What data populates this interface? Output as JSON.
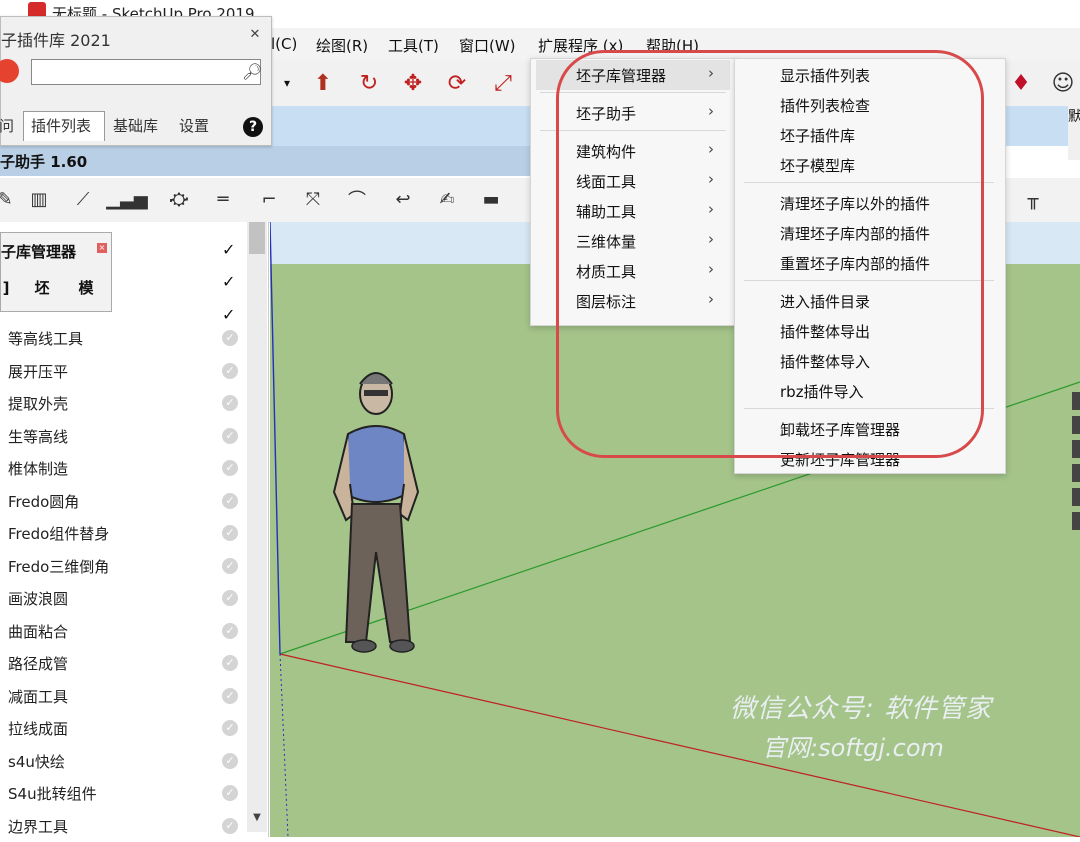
{
  "window": {
    "title": "无标题 - SketchUp Pro 2019"
  },
  "menubar": {
    "items": [
      "l(C)",
      "绘图(R)",
      "工具(T)",
      "窗口(W)",
      "扩展程序 (x)",
      "帮助(H)"
    ]
  },
  "plugin_panel": {
    "title": "子插件库 2021",
    "search_placeholder": "",
    "tabs": [
      "问",
      "插件列表",
      "基础库",
      "设置"
    ],
    "active_tab": "插件列表",
    "help_label": "?"
  },
  "assistant_bar": {
    "title": "子助手 1.60"
  },
  "manager_panel": {
    "title": "子库管理器",
    "buttons": [
      "]",
      "坯",
      "模"
    ]
  },
  "plugin_list": {
    "items": [
      "等高线工具",
      "展开压平",
      "提取外壳",
      "生等高线",
      "椎体制造",
      "Fredo圆角",
      "Fredo组件替身",
      "Fredo三维倒角",
      "画波浪圆",
      "曲面粘合",
      "路径成管",
      "减面工具",
      "拉线成面",
      "s4u快绘",
      "S4u批转组件",
      "边界工具"
    ]
  },
  "menu_level1": {
    "items": [
      {
        "label": "坯子库管理器",
        "submenu": true
      },
      {
        "label": "坯子助手",
        "submenu": true
      },
      {
        "label": "建筑构件",
        "submenu": true
      },
      {
        "label": "线面工具",
        "submenu": true
      },
      {
        "label": "辅助工具",
        "submenu": true
      },
      {
        "label": "三维体量",
        "submenu": true
      },
      {
        "label": "材质工具",
        "submenu": true
      },
      {
        "label": "图层标注",
        "submenu": true
      }
    ],
    "arrow": "›"
  },
  "menu_level2": {
    "groups": [
      [
        "显示插件列表",
        "插件列表检查",
        "坯子插件库",
        "坯子模型库"
      ],
      [
        "清理坯子库以外的插件",
        "清理坯子库内部的插件",
        "重置坯子库内部的插件"
      ],
      [
        "进入插件目录",
        "插件整体导出",
        "插件整体导入",
        "rbz插件导入"
      ],
      [
        "卸载坯子库管理器",
        "更新坯子库管理器"
      ]
    ]
  },
  "watermark": {
    "line1": "微信公众号: 软件管家",
    "line2": "官网:softgj.com"
  },
  "right_panel": {
    "label": "默"
  },
  "colors": {
    "annotation": "#d84a4a",
    "ground": "#a4c48a",
    "sky": "#d8e8f4",
    "toolbar_blue": "#c8dff3"
  }
}
